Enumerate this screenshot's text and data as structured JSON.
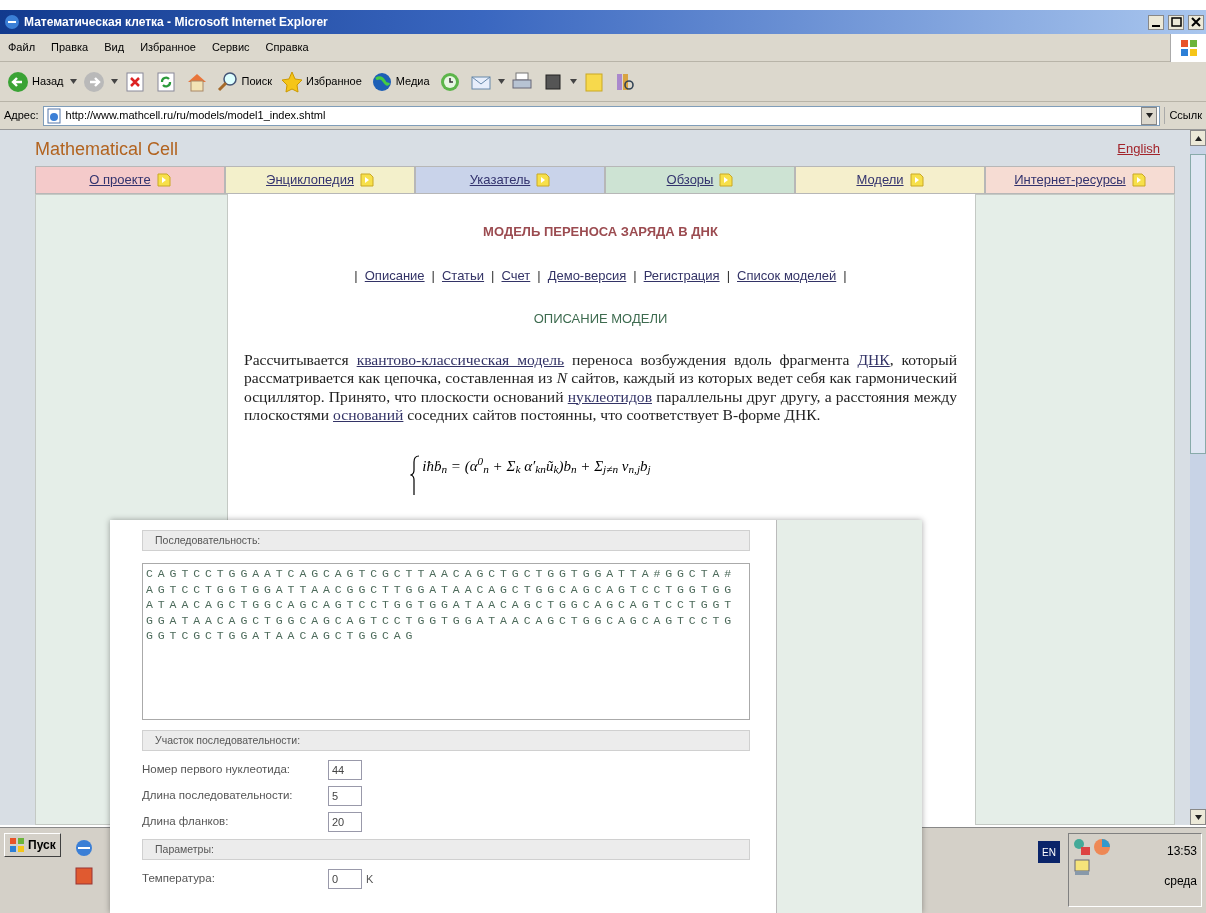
{
  "window": {
    "title": "Математическая клетка - Microsoft Internet Explorer"
  },
  "menu": [
    "Файл",
    "Правка",
    "Вид",
    "Избранное",
    "Сервис",
    "Справка"
  ],
  "toolbar": [
    {
      "kind": "back",
      "label": "Назад",
      "dropdown": true
    },
    {
      "kind": "forward",
      "dropdown": true
    },
    {
      "kind": "stop"
    },
    {
      "kind": "refresh"
    },
    {
      "kind": "home"
    },
    {
      "kind": "search",
      "label": "Поиск"
    },
    {
      "kind": "favorites",
      "label": "Избранное"
    },
    {
      "kind": "media",
      "label": "Медиа"
    },
    {
      "kind": "history"
    },
    {
      "kind": "mail",
      "dropdown": true
    },
    {
      "kind": "print"
    },
    {
      "kind": "edit",
      "dropdown": true
    },
    {
      "kind": "note"
    },
    {
      "kind": "research"
    }
  ],
  "address": {
    "label": "Адрес:",
    "value": "http://www.mathcell.ru/ru/models/model1_index.shtml",
    "links": "Ссылк"
  },
  "site": {
    "logo": "Mathematical Cell",
    "language_link": "English"
  },
  "nav": [
    {
      "label": "О проекте",
      "color": "#f4caca"
    },
    {
      "label": "Энциклопедия",
      "color": "#f3f0cb"
    },
    {
      "label": "Указатель",
      "color": "#c9d3ea"
    },
    {
      "label": "Обзоры",
      "color": "#cde3d3"
    },
    {
      "label": "Модели",
      "color": "#f5efcc"
    },
    {
      "label": "Интернет-ресурсы",
      "color": "#f6dcd3"
    }
  ],
  "article": {
    "title": "МОДЕЛЬ ПЕРЕНОСА ЗАРЯДА В ДНК",
    "separator": "|",
    "sublinks": [
      "Описание",
      "Статьи",
      "Счет",
      "Демо-версия",
      "Регистрация",
      "Список моделей"
    ],
    "heading": "ОПИСАНИЕ МОДЕЛИ",
    "paragraph": [
      {
        "text": "Рассчитывается ",
        "link": false
      },
      {
        "text": "квантово-классическая модель",
        "link": true
      },
      {
        "text": " переноса возбуждения вдоль фрагмента ",
        "link": false
      },
      {
        "text": "ДНК",
        "link": true
      },
      {
        "text": ", который рассматривается как цепочка, составленная из *N* сайтов, каждый из которых ведет себя как гармонический осциллятор. Принято, что плоскости оснований ",
        "link": false
      },
      {
        "text": "нуклеотидов",
        "link": true
      },
      {
        "text": " параллельны друг другу, а расстояния между плоскостями ",
        "link": false
      },
      {
        "text": "оснований",
        "link": true
      },
      {
        "text": " соседних сайтов постоянны, что соответствует B-форме ДНК.",
        "link": false
      }
    ],
    "formula": "iħḃ$_{n}$ = (α$^{0}$$_{n}$ + Σ$_{k}$ α′$_{kn}$ũ$_{k}$)b$_{n}$ + Σ$_{j≠n}$ ν$_{n,j}$b$_{j}$"
  },
  "panel": {
    "sections": [
      {
        "kind": "sequence",
        "title": "Последовательность:",
        "value": "CAGTCCTGGAATCAGCAGTCGCTTAACAGCTGCTGGTGGATTA#GGCTA#\nAGTCCTGGTGGATTAACGGCTTGGATAACAGCTGGCAGCAGTCCTGGTGG\nATAACAGCTGGCAGCAGTCCTGGTGGATAACAGCTGGCAGCAGTCCTGGT\nGGATAACAGCTGGCAGCAGTCCTGGTGGATAACAGCTGGCAGCAGTCCTG\nGGTCGCTGGATAACAGCTGGCAG"
      },
      {
        "kind": "fields",
        "title": "Участок последовательности:",
        "fields": [
          {
            "label": "Номер первого нуклеотида:",
            "value": "44"
          },
          {
            "label": "Длина последовательности:",
            "value": "5"
          },
          {
            "label": "Длина фланков:",
            "value": "20"
          }
        ]
      },
      {
        "kind": "fields",
        "title": "Параметры:",
        "fields": [
          {
            "label": "Температура:",
            "value": "0",
            "unit": "K"
          }
        ]
      }
    ]
  },
  "taskbar": {
    "start": "Пуск",
    "language": "EN",
    "time": "13:53",
    "day": "среда"
  }
}
